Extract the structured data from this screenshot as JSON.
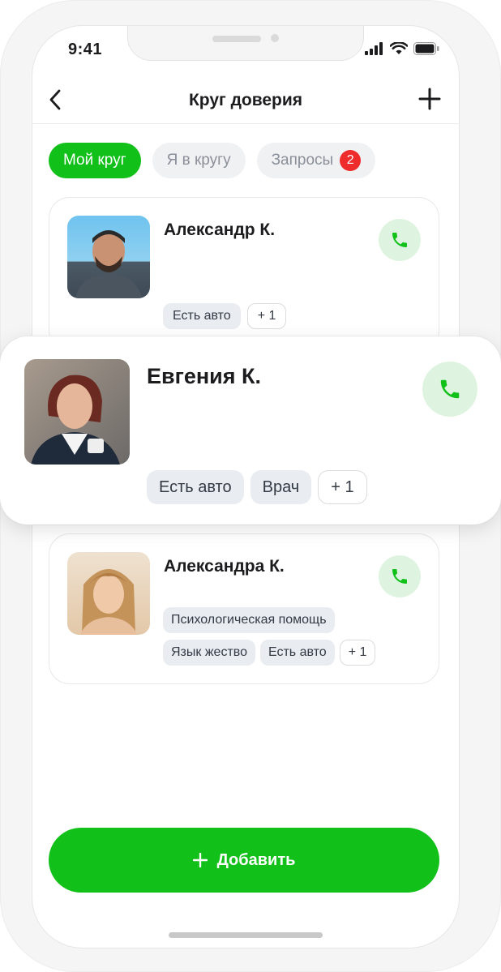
{
  "status_bar": {
    "time": "9:41"
  },
  "nav": {
    "title": "Круг доверия"
  },
  "tabs": [
    {
      "label": "Мой круг",
      "active": true
    },
    {
      "label": "Я в кругу",
      "active": false
    },
    {
      "label": "Запросы",
      "active": false,
      "badge": "2"
    }
  ],
  "contacts": [
    {
      "name": "Александр К.",
      "tags": [
        "Есть авто",
        "+ 1"
      ]
    },
    {
      "name": "Евгения К.",
      "tags": [
        "Есть авто",
        "Врач",
        "+ 1"
      ]
    },
    {
      "name": "Александра К.",
      "tags": [
        "Психологическая помощь",
        "Язык жество",
        "Есть авто",
        "+ 1"
      ]
    }
  ],
  "actions": {
    "add_label": "Добавить"
  },
  "colors": {
    "accent": "#12c01a",
    "badge": "#ee2c2c",
    "call_bg": "#dff4e0",
    "chip_bg": "#e9edf2"
  },
  "icons": [
    "back-arrow-icon",
    "plus-icon",
    "phone-icon",
    "signal-icon",
    "wifi-icon",
    "battery-icon"
  ]
}
